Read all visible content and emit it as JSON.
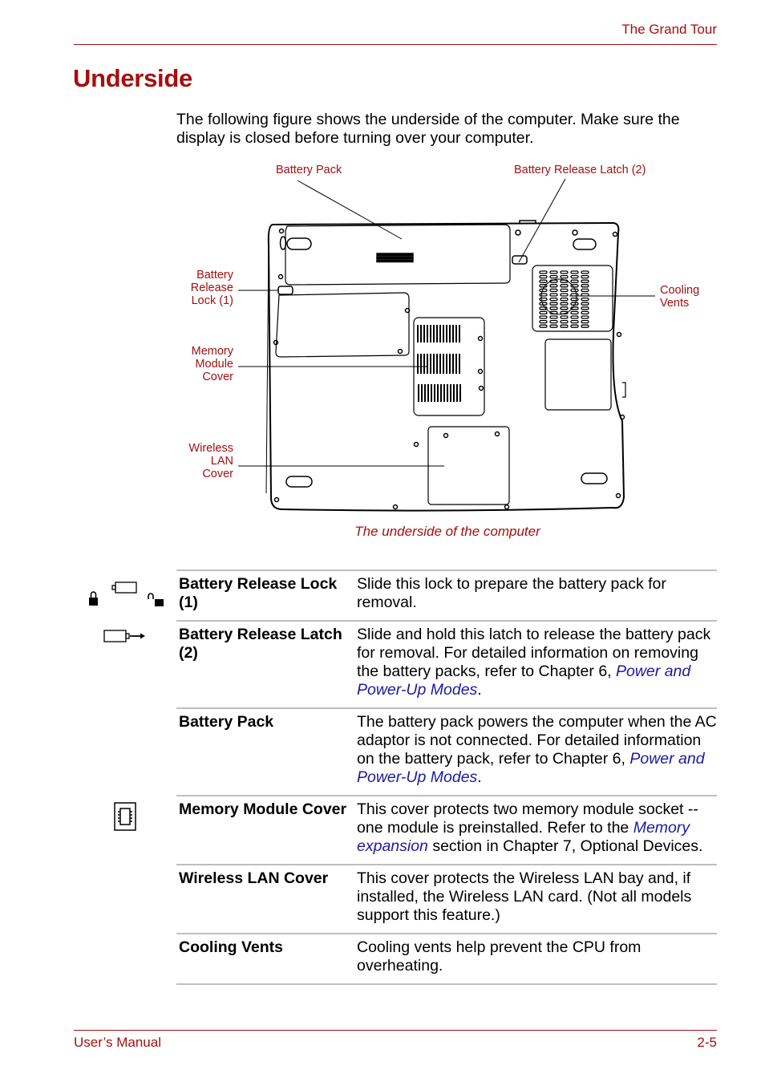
{
  "header": {
    "section": "The Grand Tour"
  },
  "title": "Underside",
  "intro": "The following figure shows the underside of the computer. Make sure the display is closed before turning over your computer.",
  "figure": {
    "callouts": {
      "battery_pack": "Battery Pack",
      "battery_release_latch": "Battery Release Latch (2)",
      "battery_release_lock": [
        "Battery",
        "Release",
        "Lock (1)"
      ],
      "memory_module_cover": [
        "Memory",
        "Module",
        "Cover"
      ],
      "wireless_lan_cover": [
        "Wireless",
        "LAN",
        "Cover"
      ],
      "cooling_vents": [
        "Cooling",
        "Vents"
      ]
    },
    "caption": "The underside of the computer"
  },
  "items": [
    {
      "term": "Battery Release Lock (1)",
      "icon": "lock-battery-unlock-icon",
      "desc": "Slide this lock to prepare the battery pack for removal.",
      "link": "",
      "after": ""
    },
    {
      "term": "Battery Release Latch (2)",
      "icon": "battery-release-icon",
      "desc": "Slide and hold this latch to release the battery pack for removal. For detailed information on removing the battery packs, refer to Chapter 6, ",
      "link": "Power and Power-Up Modes",
      "after": "."
    },
    {
      "term": "Battery Pack",
      "icon": "",
      "desc": "The battery pack powers the computer when the AC adaptor is not connected. For detailed information on the battery pack, refer to Chapter 6, ",
      "link": "Power and Power-Up Modes",
      "after": "."
    },
    {
      "term": "Memory Module Cover",
      "icon": "memory-chip-icon",
      "desc": "This cover protects two memory module socket -- one module is preinstalled. Refer to the ",
      "link": "Memory expansion",
      "after": " section in Chapter 7, Optional Devices."
    },
    {
      "term": "Wireless LAN Cover",
      "icon": "",
      "desc": "This cover protects the Wireless LAN bay and, if installed, the Wireless LAN card. (Not all models support this feature.)",
      "link": "",
      "after": ""
    },
    {
      "term": "Cooling Vents",
      "icon": "",
      "desc": "Cooling vents help prevent the CPU from overheating.",
      "link": "",
      "after": ""
    }
  ],
  "footer": {
    "left": "User’s Manual",
    "right": "2-5"
  },
  "colors": {
    "accent": "#a50f0f",
    "link": "#1a1aa6",
    "rule": "#bfbfbf"
  }
}
